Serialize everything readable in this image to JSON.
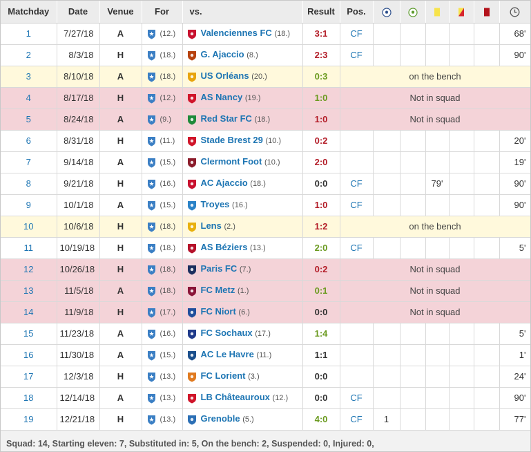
{
  "headers": {
    "matchday": "Matchday",
    "date": "Date",
    "venue": "Venue",
    "for": "For",
    "vs": "vs.",
    "result": "Result",
    "pos": "Pos.",
    "goals_icon": "soccer-ball-icon",
    "assists_icon": "assist-ball-icon",
    "yellow_icon": "yellow-card-icon",
    "yellowred_icon": "yellow-red-card-icon",
    "red_icon": "red-card-icon",
    "minutes_icon": "clock-icon"
  },
  "colors": {
    "link": "#1d75b3",
    "win": "#6a9a1f",
    "loss": "#b31d28",
    "bench_row": "#fff9dc",
    "notsquad_row": "#f4d3d8",
    "header_bg": "#ececec"
  },
  "own_team_icon": "auxerre-crest-icon",
  "rows": [
    {
      "md": "1",
      "date": "7/27/18",
      "venue": "A",
      "for_rank": "(12.)",
      "vs": "Valenciennes FC",
      "vs_rank": "(18.)",
      "vs_icon": "valenciennes-crest-icon",
      "crest": "#c8102e",
      "result": "3:1",
      "res_color": "red",
      "status": "normal",
      "pos": "CF",
      "goals": "",
      "assists": "",
      "yellow": "",
      "yellowred": "",
      "red": "",
      "minutes": "68'",
      "note": ""
    },
    {
      "md": "2",
      "date": "8/3/18",
      "venue": "H",
      "for_rank": "(18.)",
      "vs": "G. Ajaccio",
      "vs_rank": "(8.)",
      "vs_icon": "gazelec-ajaccio-crest-icon",
      "crest": "#b7410e",
      "result": "2:3",
      "res_color": "red",
      "status": "normal",
      "pos": "CF",
      "goals": "",
      "assists": "",
      "yellow": "",
      "yellowred": "",
      "red": "",
      "minutes": "90'",
      "note": ""
    },
    {
      "md": "3",
      "date": "8/10/18",
      "venue": "A",
      "for_rank": "(18.)",
      "vs": "US Orléans",
      "vs_rank": "(20.)",
      "vs_icon": "us-orleans-crest-icon",
      "crest": "#e8a40c",
      "result": "0:3",
      "res_color": "green",
      "status": "bench",
      "pos": "",
      "goals": "",
      "assists": "",
      "yellow": "",
      "yellowred": "",
      "red": "",
      "minutes": "",
      "note": "on the bench"
    },
    {
      "md": "4",
      "date": "8/17/18",
      "venue": "H",
      "for_rank": "(12.)",
      "vs": "AS Nancy",
      "vs_rank": "(19.)",
      "vs_icon": "as-nancy-crest-icon",
      "crest": "#d0152a",
      "result": "1:0",
      "res_color": "green",
      "status": "notsquad",
      "pos": "",
      "goals": "",
      "assists": "",
      "yellow": "",
      "yellowred": "",
      "red": "",
      "minutes": "",
      "note": "Not in squad"
    },
    {
      "md": "5",
      "date": "8/24/18",
      "venue": "A",
      "for_rank": "(9.)",
      "vs": "Red Star FC",
      "vs_rank": "(18.)",
      "vs_icon": "red-star-crest-icon",
      "crest": "#1f8a3a",
      "result": "1:0",
      "res_color": "red",
      "status": "notsquad",
      "pos": "",
      "goals": "",
      "assists": "",
      "yellow": "",
      "yellowred": "",
      "red": "",
      "minutes": "",
      "note": "Not in squad"
    },
    {
      "md": "6",
      "date": "8/31/18",
      "venue": "H",
      "for_rank": "(11.)",
      "vs": "Stade Brest 29",
      "vs_rank": "(10.)",
      "vs_icon": "stade-brest-crest-icon",
      "crest": "#d0152a",
      "result": "0:2",
      "res_color": "red",
      "status": "normal",
      "pos": "",
      "goals": "",
      "assists": "",
      "yellow": "",
      "yellowred": "",
      "red": "",
      "minutes": "20'",
      "note": ""
    },
    {
      "md": "7",
      "date": "9/14/18",
      "venue": "A",
      "for_rank": "(15.)",
      "vs": "Clermont Foot",
      "vs_rank": "(10.)",
      "vs_icon": "clermont-foot-crest-icon",
      "crest": "#8b1c2b",
      "result": "2:0",
      "res_color": "red",
      "status": "normal",
      "pos": "",
      "goals": "",
      "assists": "",
      "yellow": "",
      "yellowred": "",
      "red": "",
      "minutes": "19'",
      "note": ""
    },
    {
      "md": "8",
      "date": "9/21/18",
      "venue": "H",
      "for_rank": "(16.)",
      "vs": "AC Ajaccio",
      "vs_rank": "(18.)",
      "vs_icon": "ac-ajaccio-crest-icon",
      "crest": "#c8102e",
      "result": "0:0",
      "res_color": "dark",
      "status": "normal",
      "pos": "CF",
      "goals": "",
      "assists": "",
      "yellow": "79'",
      "yellowred": "",
      "red": "",
      "minutes": "90'",
      "note": ""
    },
    {
      "md": "9",
      "date": "10/1/18",
      "venue": "A",
      "for_rank": "(15.)",
      "vs": "Troyes",
      "vs_rank": "(16.)",
      "vs_icon": "troyes-crest-icon",
      "crest": "#2a82c7",
      "result": "1:0",
      "res_color": "red",
      "status": "normal",
      "pos": "CF",
      "goals": "",
      "assists": "",
      "yellow": "",
      "yellowred": "",
      "red": "",
      "minutes": "90'",
      "note": ""
    },
    {
      "md": "10",
      "date": "10/6/18",
      "venue": "H",
      "for_rank": "(18.)",
      "vs": "Lens",
      "vs_rank": "(2.)",
      "vs_icon": "rc-lens-crest-icon",
      "crest": "#e8b00c",
      "result": "1:2",
      "res_color": "red",
      "status": "bench",
      "pos": "",
      "goals": "",
      "assists": "",
      "yellow": "",
      "yellowred": "",
      "red": "",
      "minutes": "",
      "note": "on the bench"
    },
    {
      "md": "11",
      "date": "10/19/18",
      "venue": "H",
      "for_rank": "(18.)",
      "vs": "AS Béziers",
      "vs_rank": "(13.)",
      "vs_icon": "as-beziers-crest-icon",
      "crest": "#b5122b",
      "result": "2:0",
      "res_color": "green",
      "status": "normal",
      "pos": "CF",
      "goals": "",
      "assists": "",
      "yellow": "",
      "yellowred": "",
      "red": "",
      "minutes": "5'",
      "note": ""
    },
    {
      "md": "12",
      "date": "10/26/18",
      "venue": "H",
      "for_rank": "(18.)",
      "vs": "Paris FC",
      "vs_rank": "(7.)",
      "vs_icon": "paris-fc-crest-icon",
      "crest": "#1c2f5e",
      "result": "0:2",
      "res_color": "red",
      "status": "notsquad",
      "pos": "",
      "goals": "",
      "assists": "",
      "yellow": "",
      "yellowred": "",
      "red": "",
      "minutes": "",
      "note": "Not in squad"
    },
    {
      "md": "13",
      "date": "11/5/18",
      "venue": "A",
      "for_rank": "(18.)",
      "vs": "FC Metz",
      "vs_rank": "(1.)",
      "vs_icon": "fc-metz-crest-icon",
      "crest": "#8a1538",
      "result": "0:1",
      "res_color": "green",
      "status": "notsquad",
      "pos": "",
      "goals": "",
      "assists": "",
      "yellow": "",
      "yellowred": "",
      "red": "",
      "minutes": "",
      "note": "Not in squad"
    },
    {
      "md": "14",
      "date": "11/9/18",
      "venue": "H",
      "for_rank": "(17.)",
      "vs": "FC Niort",
      "vs_rank": "(6.)",
      "vs_icon": "chamois-niortais-crest-icon",
      "crest": "#1f4e9c",
      "result": "0:0",
      "res_color": "dark",
      "status": "notsquad",
      "pos": "",
      "goals": "",
      "assists": "",
      "yellow": "",
      "yellowred": "",
      "red": "",
      "minutes": "",
      "note": "Not in squad"
    },
    {
      "md": "15",
      "date": "11/23/18",
      "venue": "A",
      "for_rank": "(16.)",
      "vs": "FC Sochaux",
      "vs_rank": "(17.)",
      "vs_icon": "fc-sochaux-crest-icon",
      "crest": "#1f3a8a",
      "result": "1:4",
      "res_color": "green",
      "status": "normal",
      "pos": "",
      "goals": "",
      "assists": "",
      "yellow": "",
      "yellowred": "",
      "red": "",
      "minutes": "5'",
      "note": ""
    },
    {
      "md": "16",
      "date": "11/30/18",
      "venue": "A",
      "for_rank": "(15.)",
      "vs": "AC Le Havre",
      "vs_rank": "(11.)",
      "vs_icon": "le-havre-crest-icon",
      "crest": "#1b4f8c",
      "result": "1:1",
      "res_color": "dark",
      "status": "normal",
      "pos": "",
      "goals": "",
      "assists": "",
      "yellow": "",
      "yellowred": "",
      "red": "",
      "minutes": "1'",
      "note": ""
    },
    {
      "md": "17",
      "date": "12/3/18",
      "venue": "H",
      "for_rank": "(13.)",
      "vs": "FC Lorient",
      "vs_rank": "(3.)",
      "vs_icon": "fc-lorient-crest-icon",
      "crest": "#e07a1f",
      "result": "0:0",
      "res_color": "dark",
      "status": "normal",
      "pos": "",
      "goals": "",
      "assists": "",
      "yellow": "",
      "yellowred": "",
      "red": "",
      "minutes": "24'",
      "note": ""
    },
    {
      "md": "18",
      "date": "12/14/18",
      "venue": "A",
      "for_rank": "(13.)",
      "vs": "LB Châteauroux",
      "vs_rank": "(12.)",
      "vs_icon": "lb-chateauroux-crest-icon",
      "crest": "#d0152a",
      "result": "0:0",
      "res_color": "dark",
      "status": "normal",
      "pos": "CF",
      "goals": "",
      "assists": "",
      "yellow": "",
      "yellowred": "",
      "red": "",
      "minutes": "90'",
      "note": ""
    },
    {
      "md": "19",
      "date": "12/21/18",
      "venue": "H",
      "for_rank": "(13.)",
      "vs": "Grenoble",
      "vs_rank": "(5.)",
      "vs_icon": "grenoble-foot-crest-icon",
      "crest": "#2b6fb5",
      "result": "4:0",
      "res_color": "green",
      "status": "normal",
      "pos": "CF",
      "goals": "1",
      "assists": "",
      "yellow": "",
      "yellowred": "",
      "red": "",
      "minutes": "77'",
      "note": ""
    }
  ],
  "summary": "Squad: 14, Starting eleven: 7, Substituted in: 5, On the bench: 2, Suspended: 0, Injured: 0,"
}
